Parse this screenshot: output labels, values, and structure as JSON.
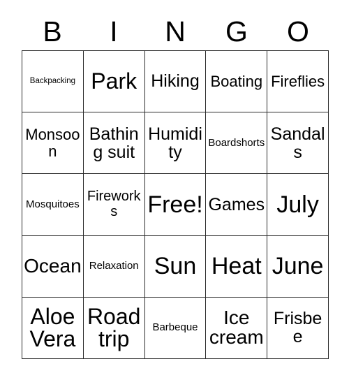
{
  "card": {
    "title_letters": [
      "B",
      "I",
      "N",
      "G",
      "O"
    ],
    "free_space_label": "Free!",
    "colors": {
      "background": "#ffffff",
      "text": "#000000",
      "grid_line": "#2b2b2b"
    },
    "grid": {
      "columns": 5,
      "rows": 5,
      "cells": [
        {
          "text": "Backpacking",
          "size": "fs-xs"
        },
        {
          "text": "Park",
          "size": "fs-xxl"
        },
        {
          "text": "Hiking",
          "size": "fs-l"
        },
        {
          "text": "Boating",
          "size": "fs-ml"
        },
        {
          "text": "Fireflies",
          "size": "fs-ml"
        },
        {
          "text": "Monsoon",
          "size": "fs-ml"
        },
        {
          "text": "Bathing suit",
          "size": "fs-l"
        },
        {
          "text": "Humidity",
          "size": "fs-l"
        },
        {
          "text": "Boardshorts",
          "size": "fs-s"
        },
        {
          "text": "Sandals",
          "size": "fs-l"
        },
        {
          "text": "Mosquitoes",
          "size": "fs-s"
        },
        {
          "text": "Fireworks",
          "size": "fs-m"
        },
        {
          "text": "Free!",
          "size": "fs-hg"
        },
        {
          "text": "Games",
          "size": "fs-l"
        },
        {
          "text": "July",
          "size": "fs-hg"
        },
        {
          "text": "Ocean",
          "size": "fs-xl"
        },
        {
          "text": "Relaxation",
          "size": "fs-s"
        },
        {
          "text": "Sun",
          "size": "fs-hg"
        },
        {
          "text": "Heat",
          "size": "fs-hg"
        },
        {
          "text": "June",
          "size": "fs-hg"
        },
        {
          "text": "Aloe Vera",
          "size": "fs-xxl"
        },
        {
          "text": "Road trip",
          "size": "fs-xxl"
        },
        {
          "text": "Barbeque",
          "size": "fs-s"
        },
        {
          "text": "Ice cream",
          "size": "fs-xl"
        },
        {
          "text": "Frisbee",
          "size": "fs-l"
        }
      ]
    }
  }
}
